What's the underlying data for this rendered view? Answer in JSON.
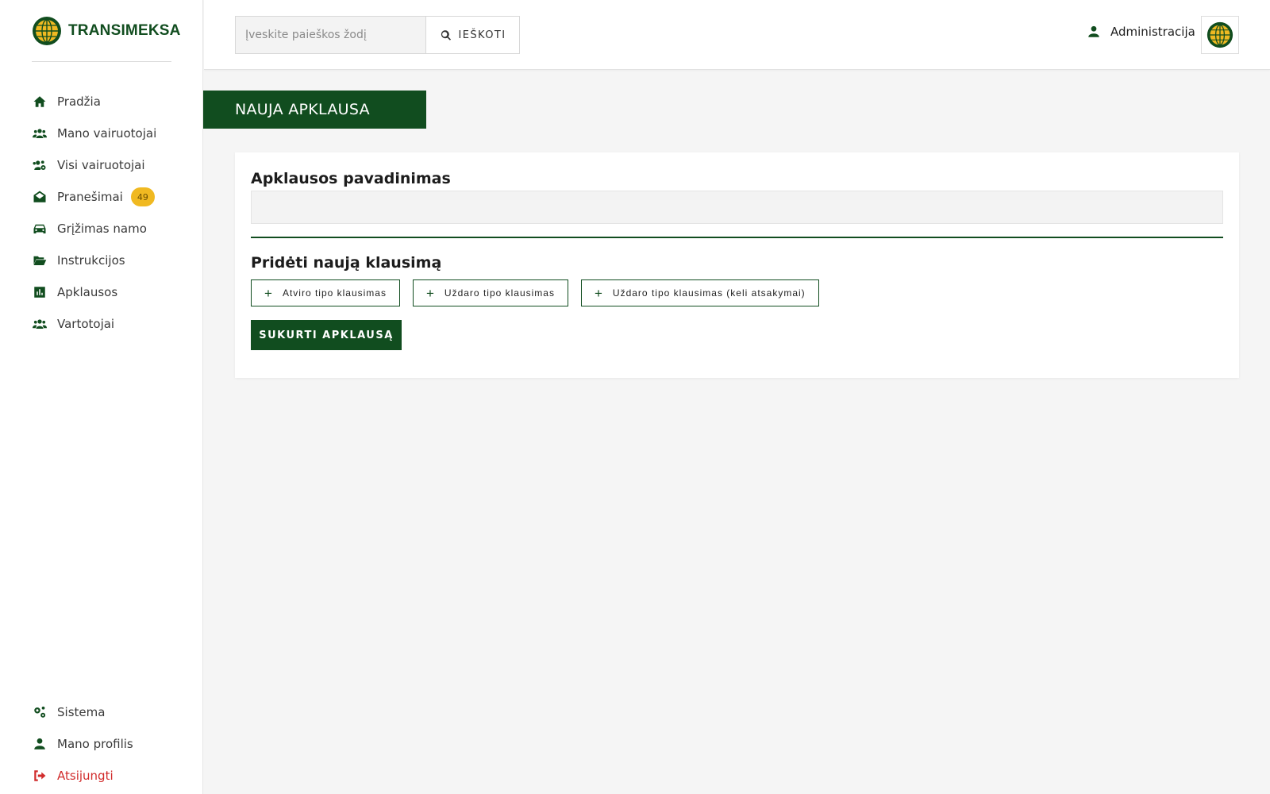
{
  "brand": {
    "name": "TRANSIMEKSA",
    "logo_icon": "globe-logo-icon",
    "primary_color": "#114d1f",
    "accent_color": "#f0b921"
  },
  "sidebar": {
    "items": [
      {
        "label": "Pradžia",
        "icon": "home-icon"
      },
      {
        "label": "Mano vairuotojai",
        "icon": "users-icon"
      },
      {
        "label": "Visi vairuotojai",
        "icon": "users-cog-icon"
      },
      {
        "label": "Pranešimai",
        "icon": "envelope-open-icon",
        "badge": "49"
      },
      {
        "label": "Grįžimas namo",
        "icon": "car-icon"
      },
      {
        "label": "Instrukcijos",
        "icon": "folder-open-icon"
      },
      {
        "label": "Apklausos",
        "icon": "poll-icon"
      },
      {
        "label": "Vartotojai",
        "icon": "users-icon"
      }
    ],
    "bottom_items": [
      {
        "label": "Sistema",
        "icon": "cogs-icon"
      },
      {
        "label": "Mano profilis",
        "icon": "user-icon"
      },
      {
        "label": "Atsijungti",
        "icon": "sign-out-icon",
        "color": "#d12c2c"
      }
    ]
  },
  "topbar": {
    "search": {
      "placeholder": "Įveskite paieškos žodį",
      "value": "",
      "button_label": "IEŠKOTI"
    },
    "admin_label": "Administracija"
  },
  "main": {
    "page_title": "NAUJA APKLAUSA",
    "form": {
      "title_label": "Apklausos pavadinimas",
      "title_value": "",
      "add_question_label": "Pridėti naują klausimą",
      "question_buttons": [
        "Atviro tipo klausimas",
        "Uždaro tipo klausimas",
        "Uždaro tipo klausimas (keli atsakymai)"
      ],
      "submit_label": "SUKURTI APKLAUSĄ"
    }
  }
}
